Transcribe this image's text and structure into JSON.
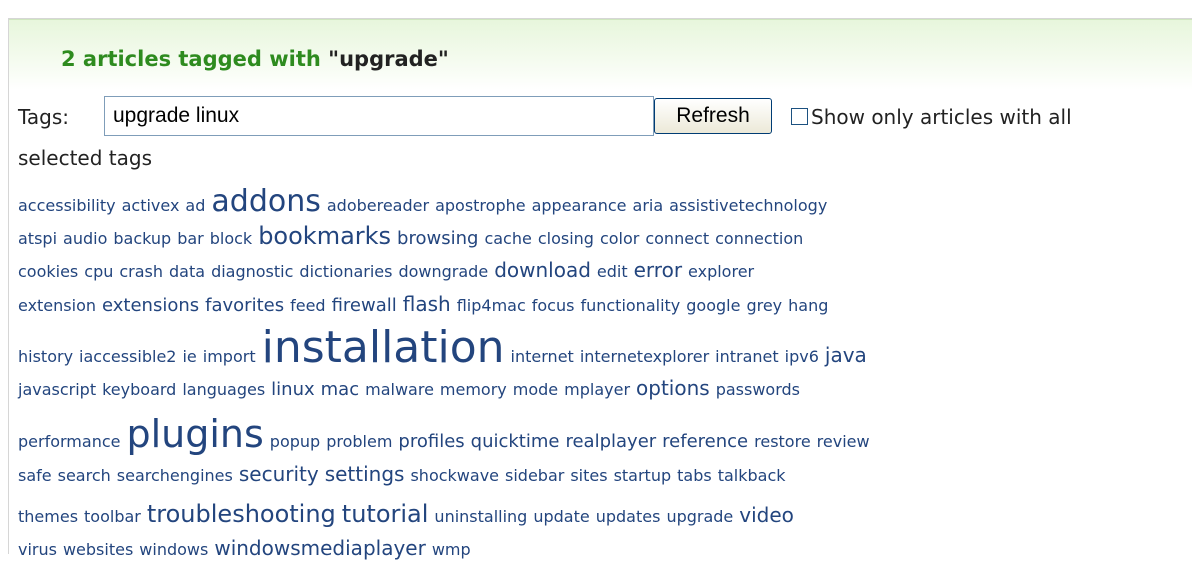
{
  "header": {
    "count_text": "2 articles tagged with",
    "tag_quoted": "\"upgrade\""
  },
  "filter": {
    "tags_label": "Tags:",
    "tags_value": "upgrade linux",
    "refresh_label": "Refresh",
    "show_only_label": "Show only articles with all",
    "show_only_label_cont": "selected tags",
    "show_only_checked": false
  },
  "cloud": {
    "link_color": "#23457e",
    "lines": [
      [
        [
          "accessibility",
          1
        ],
        [
          "activex",
          1
        ],
        [
          "ad",
          1
        ],
        [
          "addons",
          5
        ],
        [
          "adobereader",
          1
        ],
        [
          "apostrophe",
          1
        ],
        [
          "appearance",
          1
        ],
        [
          "aria",
          1
        ],
        [
          "assistivetechnology",
          1
        ]
      ],
      [
        [
          "atspi",
          1
        ],
        [
          "audio",
          1
        ],
        [
          "backup",
          1
        ],
        [
          "bar",
          1
        ],
        [
          "block",
          1
        ],
        [
          "bookmarks",
          4
        ],
        [
          "browsing",
          2
        ],
        [
          "cache",
          1
        ],
        [
          "closing",
          1
        ],
        [
          "color",
          1
        ],
        [
          "connect",
          1
        ],
        [
          "connection",
          1
        ]
      ],
      [
        [
          "cookies",
          1
        ],
        [
          "cpu",
          1
        ],
        [
          "crash",
          1
        ],
        [
          "data",
          1
        ],
        [
          "diagnostic",
          1
        ],
        [
          "dictionaries",
          1
        ],
        [
          "downgrade",
          1
        ],
        [
          "download",
          3
        ],
        [
          "edit",
          1
        ],
        [
          "error",
          3
        ],
        [
          "explorer",
          1
        ]
      ],
      [
        [
          "extension",
          1
        ],
        [
          "extensions",
          2
        ],
        [
          "favorites",
          2
        ],
        [
          "feed",
          1
        ],
        [
          "firewall",
          2
        ],
        [
          "flash",
          3
        ],
        [
          "flip4mac",
          1
        ],
        [
          "focus",
          1
        ],
        [
          "functionality",
          1
        ],
        [
          "google",
          1
        ],
        [
          "grey",
          1
        ],
        [
          "hang",
          1
        ]
      ],
      [
        [
          "history",
          1
        ],
        [
          "iaccessible2",
          1
        ],
        [
          "ie",
          1
        ],
        [
          "import",
          1
        ],
        [
          "installation",
          7
        ],
        [
          "internet",
          1
        ],
        [
          "internetexplorer",
          1
        ],
        [
          "intranet",
          1
        ],
        [
          "ipv6",
          1
        ],
        [
          "java",
          3
        ]
      ],
      [
        [
          "javascript",
          1
        ],
        [
          "keyboard",
          1
        ],
        [
          "languages",
          1
        ],
        [
          "linux",
          2
        ],
        [
          "mac",
          2
        ],
        [
          "malware",
          1
        ],
        [
          "memory",
          1
        ],
        [
          "mode",
          1
        ],
        [
          "mplayer",
          1
        ],
        [
          "options",
          3
        ],
        [
          "passwords",
          1
        ]
      ],
      [
        [
          "performance",
          1
        ],
        [
          "plugins",
          6
        ],
        [
          "popup",
          1
        ],
        [
          "problem",
          1
        ],
        [
          "profiles",
          2
        ],
        [
          "quicktime",
          2
        ],
        [
          "realplayer",
          2
        ],
        [
          "reference",
          2
        ],
        [
          "restore",
          1
        ],
        [
          "review",
          1
        ]
      ],
      [
        [
          "safe",
          1
        ],
        [
          "search",
          1
        ],
        [
          "searchengines",
          1
        ],
        [
          "security",
          3
        ],
        [
          "settings",
          3
        ],
        [
          "shockwave",
          1
        ],
        [
          "sidebar",
          1
        ],
        [
          "sites",
          1
        ],
        [
          "startup",
          1
        ],
        [
          "tabs",
          1
        ],
        [
          "talkback",
          1
        ]
      ],
      [
        [
          "themes",
          1
        ],
        [
          "toolbar",
          1
        ],
        [
          "troubleshooting",
          4
        ],
        [
          "tutorial",
          4
        ],
        [
          "uninstalling",
          1
        ],
        [
          "update",
          1
        ],
        [
          "updates",
          1
        ],
        [
          "upgrade",
          1
        ],
        [
          "video",
          3
        ]
      ],
      [
        [
          "virus",
          1
        ],
        [
          "websites",
          1
        ],
        [
          "windows",
          1
        ],
        [
          "windowsmediaplayer",
          3
        ],
        [
          "wmp",
          1
        ]
      ]
    ]
  }
}
